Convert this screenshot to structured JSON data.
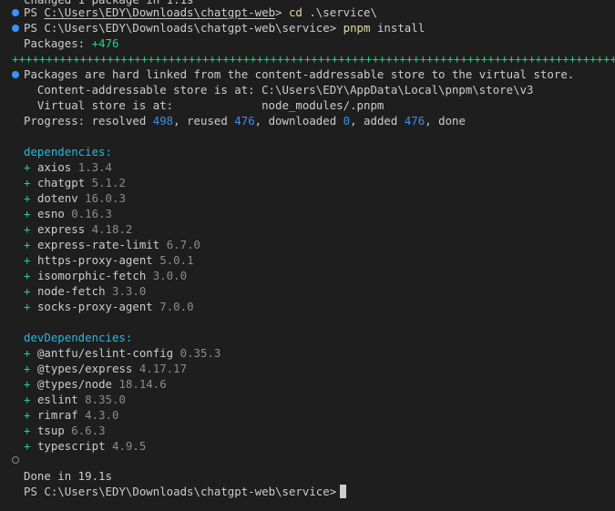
{
  "terminal": {
    "cut_top_line": "changed 1 package in 1.1s",
    "prompt_prefix": "PS ",
    "cmd1": {
      "path": "C:\\Users\\EDY\\Downloads\\chatgpt-web",
      "gt": ">",
      "command": "cd",
      "arg": " .\\service\\"
    },
    "cmd2": {
      "path": "C:\\Users\\EDY\\Downloads\\chatgpt-web\\service",
      "gt": ">",
      "command": "pnpm",
      "arg": " install"
    },
    "packages_label": "Packages: ",
    "packages_count": "+476",
    "progress_bar": "++++++++++++++++++++++++++++++++++++++++++++++++++++++++++++++++++++++++++++++++++++++++++++++++++++",
    "hardlink_note": "Packages are hard linked from the content-addressable store to the virtual store.",
    "store_line": "  Content-addressable store is at: C:\\Users\\EDY\\AppData\\Local\\pnpm\\store\\v3",
    "virtual_line": "  Virtual store is at:             node_modules/.pnpm",
    "progress": {
      "prefix": "Progress: resolved ",
      "resolved": "498",
      "reused_label": ", reused ",
      "reused": "476",
      "downloaded_label": ", downloaded ",
      "downloaded": "0",
      "added_label": ", added ",
      "added": "476",
      "suffix": ", done"
    },
    "dependencies_header": "dependencies:",
    "dependencies": [
      {
        "name": "axios",
        "version": "1.3.4"
      },
      {
        "name": "chatgpt",
        "version": "5.1.2"
      },
      {
        "name": "dotenv",
        "version": "16.0.3"
      },
      {
        "name": "esno",
        "version": "0.16.3"
      },
      {
        "name": "express",
        "version": "4.18.2"
      },
      {
        "name": "express-rate-limit",
        "version": "6.7.0"
      },
      {
        "name": "https-proxy-agent",
        "version": "5.0.1"
      },
      {
        "name": "isomorphic-fetch",
        "version": "3.0.0"
      },
      {
        "name": "node-fetch",
        "version": "3.3.0"
      },
      {
        "name": "socks-proxy-agent",
        "version": "7.0.0"
      }
    ],
    "dev_dependencies_header": "devDependencies:",
    "dev_dependencies": [
      {
        "name": "@antfu/eslint-config",
        "version": "0.35.3"
      },
      {
        "name": "@types/express",
        "version": "4.17.17"
      },
      {
        "name": "@types/node",
        "version": "18.14.6"
      },
      {
        "name": "eslint",
        "version": "8.35.0"
      },
      {
        "name": "rimraf",
        "version": "4.3.0"
      },
      {
        "name": "tsup",
        "version": "6.6.3"
      },
      {
        "name": "typescript",
        "version": "4.9.5"
      }
    ],
    "plus_sign": "+",
    "done_line": "Done in 19.1s",
    "final_prompt": {
      "path": "C:\\Users\\EDY\\Downloads\\chatgpt-web\\service",
      "gt": ">"
    },
    "colors": {
      "background": "#1e1e1e",
      "text": "#cccccc",
      "command_yellow": "#dcdcaa",
      "green": "#23d18b",
      "cyan": "#29b8db",
      "blue_number": "#3b8eea",
      "version_gray": "#8c8c8c",
      "gutter_dot": "#3794ff"
    }
  }
}
